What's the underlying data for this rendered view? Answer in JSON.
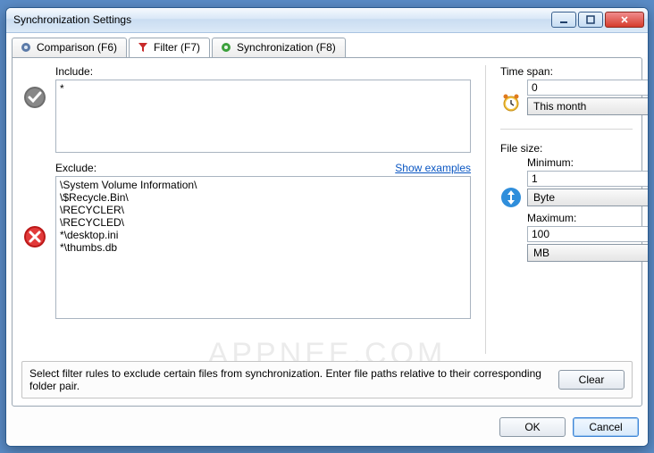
{
  "window": {
    "title": "Synchronization Settings"
  },
  "tabs": {
    "comparison": "Comparison (F6)",
    "filter": "Filter (F7)",
    "sync": "Synchronization (F8)"
  },
  "include": {
    "label": "Include:",
    "value": "*"
  },
  "exclude": {
    "label": "Exclude:",
    "show_examples": "Show examples",
    "value": "\\System Volume Information\\\n\\$Recycle.Bin\\\n\\RECYCLER\\\n\\RECYCLED\\\n*\\desktop.ini\n*\\thumbs.db"
  },
  "timespan": {
    "label": "Time span:",
    "value": "0",
    "unit": "This month"
  },
  "filesize": {
    "label": "File size:",
    "min_label": "Minimum:",
    "min_value": "1",
    "min_unit": "Byte",
    "max_label": "Maximum:",
    "max_value": "100",
    "max_unit": "MB"
  },
  "info": {
    "text": "Select filter rules to exclude certain files from synchronization. Enter file paths relative to their corresponding folder pair.",
    "clear": "Clear"
  },
  "buttons": {
    "ok": "OK",
    "cancel": "Cancel"
  },
  "watermark": "APPNEE.COM"
}
